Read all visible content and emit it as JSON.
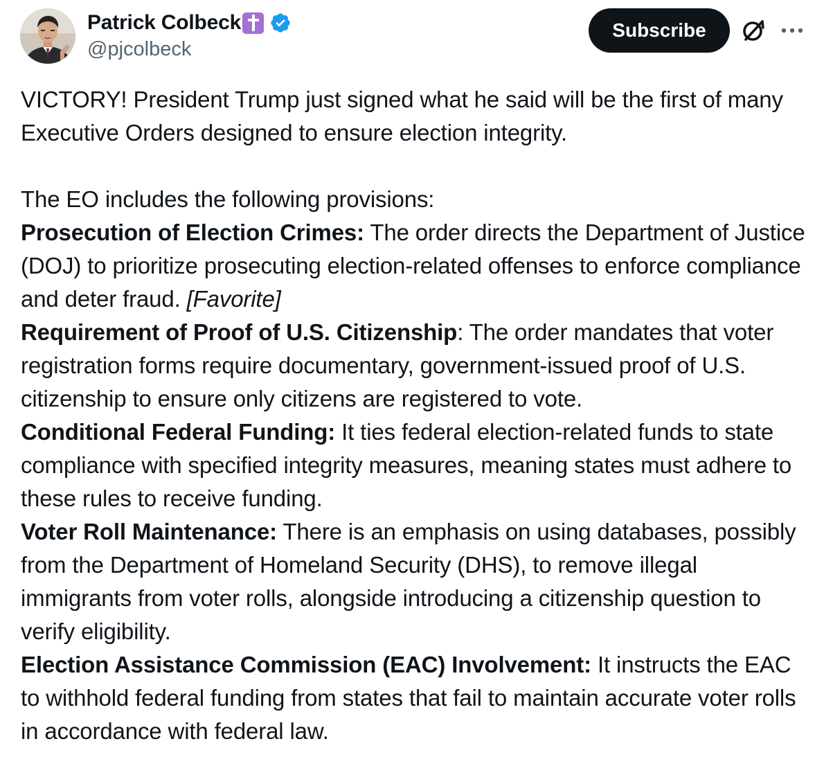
{
  "author": {
    "display_name": "Patrick Colbeck",
    "handle": "@pjcolbeck",
    "badge_emoji": "✝",
    "verified": true
  },
  "header": {
    "subscribe_label": "Subscribe"
  },
  "colors": {
    "text": "#0f1419",
    "secondary_text": "#536471",
    "verified_blue": "#1d9bf0",
    "subscribe_bg": "#0f1419",
    "emoji_purple": "#a56fd6"
  },
  "icons": [
    "avatar",
    "cross-emoji-icon",
    "verified-badge-icon",
    "grok-icon",
    "more-options-icon"
  ],
  "tweet": {
    "intro": "VICTORY!  President Trump just signed what he said will be the first of many Executive Orders designed to ensure election integrity.",
    "lead": "The EO includes the following provisions:",
    "provisions": [
      {
        "title": "Prosecution of Election Crimes:",
        "text": " The order directs the Department of Justice (DOJ) to prioritize prosecuting election-related offenses to enforce compliance and deter fraud. ",
        "note": "[Favorite]"
      },
      {
        "title": "Requirement of Proof of U.S. Citizenship",
        "text": ": The order mandates that voter registration forms require documentary, government-issued proof of U.S. citizenship to ensure only citizens are registered to vote."
      },
      {
        "title": "Conditional Federal Funding:",
        "text": " It ties federal election-related funds to state compliance with specified integrity measures, meaning states must adhere to these rules to receive funding."
      },
      {
        "title": "Voter Roll Maintenance:",
        "text": " There is an emphasis on using databases, possibly from the Department of Homeland Security (DHS), to remove illegal immigrants from voter rolls, alongside introducing a citizenship question to verify eligibility."
      },
      {
        "title": "Election Assistance Commission (EAC) Involvement:",
        "text": " It instructs the EAC to withhold federal funding from states that fail to maintain accurate voter rolls in accordance with federal law."
      }
    ]
  }
}
